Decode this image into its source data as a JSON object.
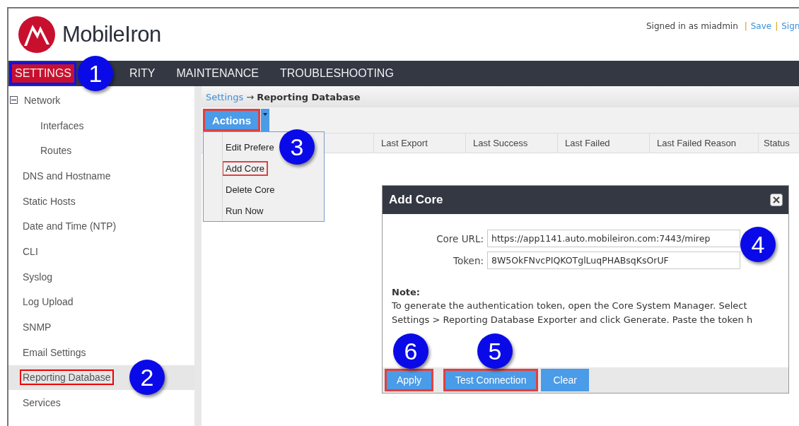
{
  "header": {
    "logo_text": "MobileIron",
    "user_text": "Signed in as miadmin",
    "separator": "|",
    "links": [
      "Save",
      "Sign"
    ]
  },
  "nav": [
    {
      "label": "SETTINGS",
      "selected": true,
      "highlighted": true
    },
    {
      "label": "RITY",
      "selected": false,
      "highlighted": false
    },
    {
      "label": "MAINTENANCE",
      "selected": false,
      "highlighted": false
    },
    {
      "label": "TROUBLESHOOTING",
      "selected": false,
      "highlighted": false
    }
  ],
  "sidebar": {
    "items": [
      {
        "label": "Network",
        "expanded": true,
        "selected": false,
        "highlighted": false,
        "children": [
          {
            "label": "Interfaces",
            "selected": false,
            "highlighted": false
          },
          {
            "label": "Routes",
            "selected": false,
            "highlighted": false
          }
        ]
      },
      {
        "label": "DNS and Hostname",
        "selected": false,
        "highlighted": false
      },
      {
        "label": "Static Hosts",
        "selected": false,
        "highlighted": false
      },
      {
        "label": "Date and Time (NTP)",
        "selected": false,
        "highlighted": false
      },
      {
        "label": "CLI",
        "selected": false,
        "highlighted": false
      },
      {
        "label": "Syslog",
        "selected": false,
        "highlighted": false
      },
      {
        "label": "Log Upload",
        "selected": false,
        "highlighted": false
      },
      {
        "label": "SNMP",
        "selected": false,
        "highlighted": false
      },
      {
        "label": "Email Settings",
        "selected": false,
        "highlighted": false
      },
      {
        "label": "Reporting Database",
        "selected": true,
        "highlighted": true
      },
      {
        "label": "Services",
        "selected": false,
        "highlighted": false
      }
    ]
  },
  "breadcrumb": {
    "parent": "Settings",
    "separator": "→",
    "current": "Reporting Database"
  },
  "toolbar": {
    "actions_button": {
      "label": "Actions",
      "highlighted": true
    }
  },
  "actions_menu": {
    "items": [
      {
        "label": "Edit Prefere",
        "highlighted": false
      },
      {
        "label": "Add Core",
        "highlighted": true
      },
      {
        "label": "Delete Core",
        "highlighted": false
      },
      {
        "label": "Run Now",
        "highlighted": false
      }
    ]
  },
  "table": {
    "columns": [
      "Last Export",
      "Last Success",
      "Last Failed",
      "Last Failed Reason",
      "Status"
    ]
  },
  "dialog": {
    "title": "Add Core",
    "fields": [
      {
        "label": "Core URL:",
        "value": "https://app1141.auto.mobileiron.com:7443/mirep"
      },
      {
        "label": "Token:",
        "value": "8W5OkFNvcPIQKOTglLuqPHABsqKsOrUF"
      }
    ],
    "note_title": "Note:",
    "note_text": "To generate the authentication token, open the Core System Manager. Select Settings > Reporting Database Exporter and click Generate. Paste the token h",
    "buttons": [
      {
        "label": "Apply",
        "highlighted": true
      },
      {
        "label": "Test Connection",
        "highlighted": true
      },
      {
        "label": "Clear",
        "highlighted": false
      }
    ]
  },
  "callouts": [
    "1",
    "2",
    "3",
    "4",
    "5",
    "6"
  ]
}
